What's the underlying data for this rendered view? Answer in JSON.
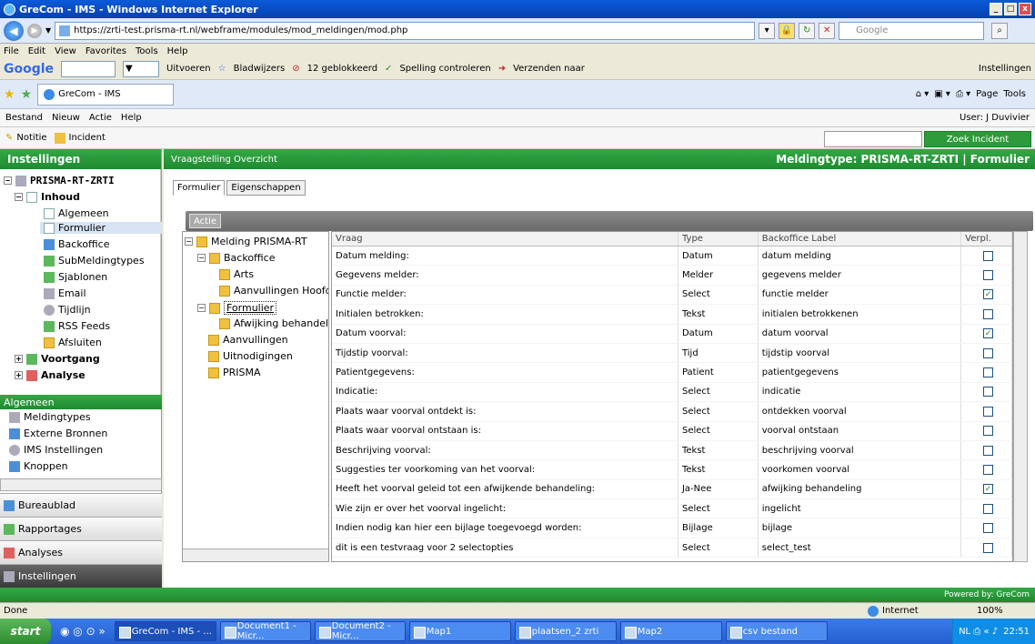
{
  "window": {
    "title": "GreCom - IMS - Windows Internet Explorer"
  },
  "browser": {
    "url": "https://zrti-test.prisma-rt.nl/webframe/modules/mod_meldingen/mod.php",
    "search_placeholder": "Google",
    "menu": [
      "File",
      "Edit",
      "View",
      "Favorites",
      "Tools",
      "Help"
    ],
    "google_bar": {
      "uitvoeren": "Uitvoeren",
      "bladwijzers": "Bladwijzers",
      "geblokkeerd": "12 geblokkeerd",
      "spelling": "Spelling controleren",
      "verzenden": "Verzenden naar",
      "instellingen": "Instellingen"
    },
    "tab_title": "GreCom - IMS",
    "page_btn": "Page",
    "tools_btn": "Tools"
  },
  "app": {
    "menu": [
      "Bestand",
      "Nieuw",
      "Actie",
      "Help"
    ],
    "user": "User: J Duvivier",
    "toolbar": {
      "notitie": "Notitie",
      "incident": "Incident",
      "zoek": "Zoek Incident"
    },
    "left_header": "Instellingen",
    "main_header_left": "Vraagstelling Overzicht",
    "main_header_right": "Meldingtype: PRISMA-RT-ZRTI | Formulier",
    "footer": "Powered by: GreCom"
  },
  "lefttree": {
    "root": "PRISMA-RT-ZRTI",
    "inhoud": "Inhoud",
    "items": [
      "Algemeen",
      "Formulier",
      "Backoffice",
      "SubMeldingtypes",
      "Sjablonen",
      "Email",
      "Tijdlijn",
      "RSS Feeds",
      "Afsluiten"
    ],
    "voortgang": "Voortgang",
    "analyse": "Analyse"
  },
  "algemeen": {
    "header": "Algemeen",
    "items": [
      "Meldingtypes",
      "Externe Bronnen",
      "IMS Instellingen",
      "Knoppen"
    ]
  },
  "sections": [
    "Bureaublad",
    "Rapportages",
    "Analyses",
    "Instellingen"
  ],
  "tabs": [
    "Formulier",
    "Eigenschappen"
  ],
  "actie": "Actie",
  "formtree": {
    "root": "Melding PRISMA-RT",
    "backoffice": "Backoffice",
    "arts": "Arts",
    "aanv_hoofd": "Aanvullingen Hoofd",
    "formulier": "Formulier",
    "afwijking": "Afwijking behandel",
    "aanvullingen": "Aanvullingen",
    "uitnodigingen": "Uitnodigingen",
    "prisma": "PRISMA"
  },
  "grid": {
    "headers": [
      "Vraag",
      "Type",
      "Backoffice Label",
      "Verpl."
    ],
    "rows": [
      [
        "Datum melding:",
        "Datum",
        "datum melding",
        false
      ],
      [
        "Gegevens melder:",
        "Melder",
        "gegevens melder",
        false
      ],
      [
        "Functie melder:",
        "Select",
        "functie melder",
        true
      ],
      [
        "Initialen betrokken:",
        "Tekst",
        "initialen betrokkenen",
        false
      ],
      [
        "Datum voorval:",
        "Datum",
        "datum voorval",
        true
      ],
      [
        "Tijdstip voorval:",
        "Tijd",
        "tijdstip voorval",
        false
      ],
      [
        "Patientgegevens:",
        "Patient",
        "patientgegevens",
        false
      ],
      [
        "Indicatie:",
        "Select",
        "indicatie",
        false
      ],
      [
        "Plaats waar voorval ontdekt is:",
        "Select",
        "ontdekken voorval",
        false
      ],
      [
        "Plaats waar voorval ontstaan is:",
        "Select",
        "voorval ontstaan",
        false
      ],
      [
        "Beschrijving voorval:",
        "Tekst",
        "beschrijving voorval",
        false
      ],
      [
        "Suggesties ter voorkoming van het voorval:",
        "Tekst",
        "voorkomen voorval",
        false
      ],
      [
        "Heeft het voorval geleid tot een afwijkende behandeling:",
        "Ja-Nee",
        "afwijking behandeling",
        true
      ],
      [
        "Wie zijn er over het voorval ingelicht:",
        "Select",
        "ingelicht",
        false
      ],
      [
        "Indien nodig kan hier een bijlage toegevoegd worden:",
        "Bijlage",
        "bijlage",
        false
      ],
      [
        "dit is een testvraag voor 2 selectopties",
        "Select",
        "select_test",
        false
      ]
    ]
  },
  "status": {
    "left": "Done",
    "zone": "Internet",
    "zoom": "100%"
  },
  "taskbar": {
    "start": "start",
    "tasks": [
      "GreCom - IMS - ...",
      "Document1 - Micr...",
      "Document2 - Micr...",
      "Map1",
      "plaatsen_2 zrti",
      "Map2",
      "csv bestand"
    ],
    "clock": "22:51"
  }
}
